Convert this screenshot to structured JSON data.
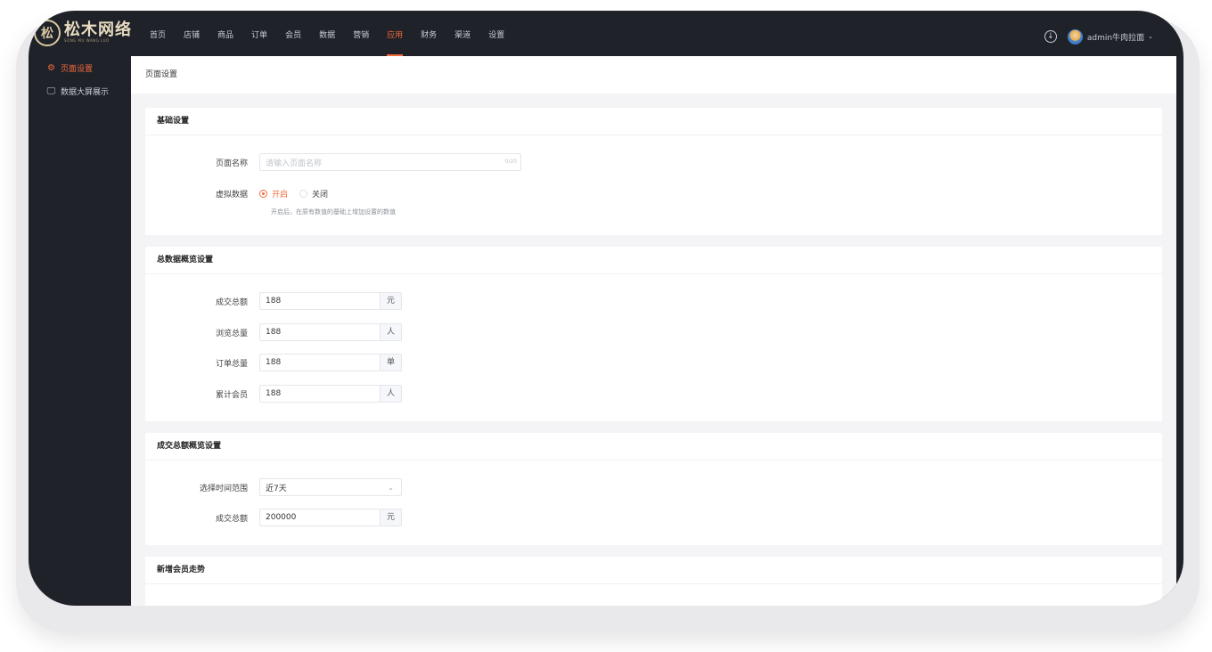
{
  "brand": {
    "name": "松木网络",
    "tagline": "SONG MU WANG LUO",
    "mark": "松"
  },
  "nav": {
    "items": [
      {
        "label": "首页"
      },
      {
        "label": "店铺"
      },
      {
        "label": "商品"
      },
      {
        "label": "订单"
      },
      {
        "label": "会员"
      },
      {
        "label": "数据"
      },
      {
        "label": "营销"
      },
      {
        "label": "应用",
        "active": true
      },
      {
        "label": "财务"
      },
      {
        "label": "渠道"
      },
      {
        "label": "设置"
      }
    ]
  },
  "user": {
    "name": "admin牛肉拉面",
    "caret": "⌄"
  },
  "icons": {
    "download": "download-icon",
    "settings": "gear-icon",
    "screen": "monitor-icon"
  },
  "colors": {
    "accent": "#f06a3c",
    "topbar": "#1f2229",
    "content_bg": "#f4f4f7"
  },
  "sidebar": {
    "items": [
      {
        "label": "页面设置",
        "active": true,
        "glyph": "⚙"
      },
      {
        "label": "数据大屏展示",
        "glyph": "🖵"
      }
    ]
  },
  "page": {
    "title": "页面设置"
  },
  "basic": {
    "title": "基础设置",
    "name_label": "页面名称",
    "name_placeholder": "请输入页面名称",
    "name_count": "0/20",
    "virtual_label": "虚拟数据",
    "on_label": "开启",
    "off_label": "关闭",
    "hint": "开启后，在原有数值的基础上增加设置的数值"
  },
  "overview": {
    "title": "总数据概览设置",
    "rows": [
      {
        "label": "成交总额",
        "value": "188",
        "unit": "元"
      },
      {
        "label": "浏览总量",
        "value": "188",
        "unit": "人"
      },
      {
        "label": "订单总量",
        "value": "188",
        "unit": "单"
      },
      {
        "label": "累计会员",
        "value": "188",
        "unit": "人"
      }
    ]
  },
  "turnover": {
    "title": "成交总额概览设置",
    "range_label": "选择时间范围",
    "range_value": "近7天",
    "amount_label": "成交总额",
    "amount_value": "200000",
    "amount_unit": "元"
  },
  "members": {
    "title": "新增会员走势"
  }
}
